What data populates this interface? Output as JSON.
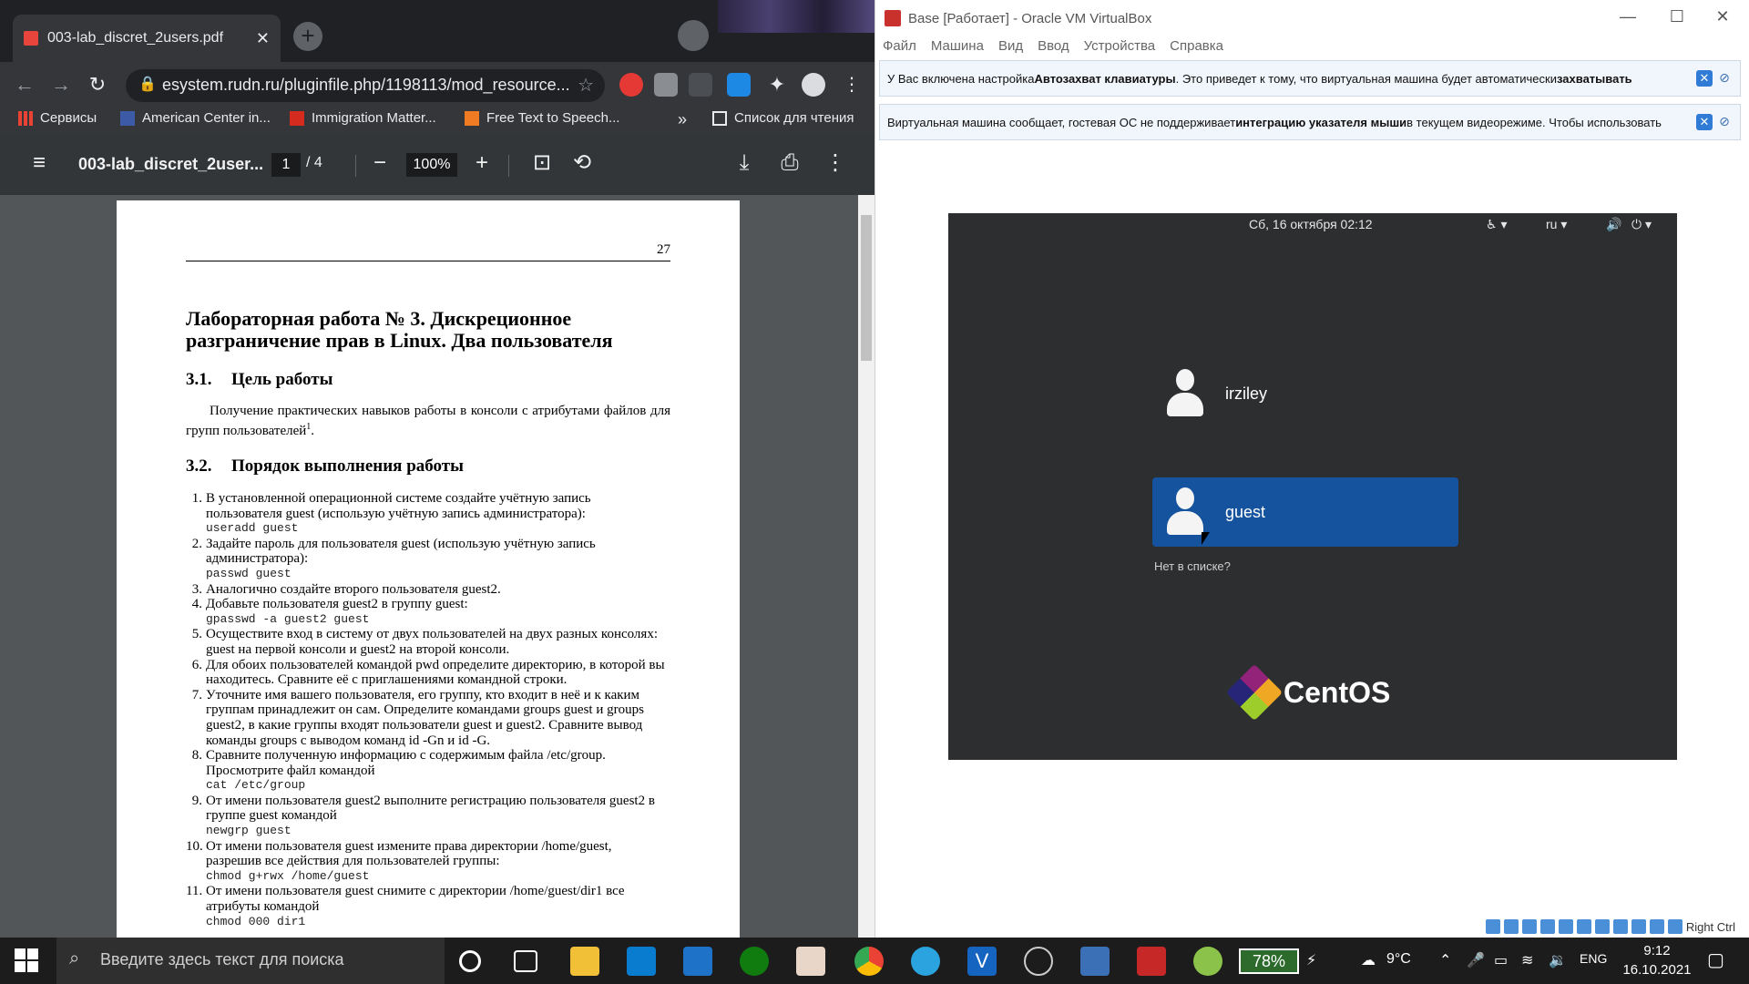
{
  "chrome": {
    "tab_title": "003-lab_discret_2users.pdf",
    "url": "esystem.rudn.ru/pluginfile.php/1198113/mod_resource...",
    "bookmarks": [
      "Сервисы",
      "American Center in...",
      "Immigration Matter...",
      "Free Text to Speech...",
      "Список для чтения"
    ],
    "bookmarks_more": "»"
  },
  "pdf": {
    "title": "003-lab_discret_2user...",
    "page_current": "1",
    "page_total": "/  4",
    "zoom": "100%",
    "page_number": "27",
    "heading": "Лабораторная работа № 3.   Дискреционное разграничение прав в Linux. Два пользователя",
    "sec1_num": "3.1.",
    "sec1_title": "Цель работы",
    "goal": "Получение практических навыков работы в консоли с атрибутами файлов для групп пользователей",
    "goal_sup": "1",
    "sec2_num": "3.2.",
    "sec2_title": "Порядок выполнения работы",
    "steps": [
      {
        "n": "1.",
        "text": "В установленной операционной системе создайте учётную запись пользователя guest (использую учётную запись администратора):",
        "cmd": "useradd guest"
      },
      {
        "n": "2.",
        "text": "Задайте пароль для пользователя guest (использую учётную запись администратора):",
        "cmd": "passwd guest"
      },
      {
        "n": "3.",
        "text": "Аналогично создайте второго пользователя guest2.",
        "cmd": ""
      },
      {
        "n": "4.",
        "text": "Добавьте пользователя guest2 в группу guest:",
        "cmd": "gpasswd -a guest2 guest"
      },
      {
        "n": "5.",
        "text": "Осуществите вход в систему от двух пользователей на двух разных консолях: guest на первой консоли и guest2 на второй консоли.",
        "cmd": ""
      },
      {
        "n": "6.",
        "text": "Для обоих пользователей командой pwd определите директорию, в которой вы находитесь. Сравните её с приглашениями командной строки.",
        "cmd": ""
      },
      {
        "n": "7.",
        "text": "Уточните имя вашего пользователя, его группу, кто входит в неё и к каким группам принадлежит он сам. Определите командами groups guest и groups guest2, в какие группы входят пользователи guest и guest2. Сравните вывод команды groups с выводом команд id -Gn и id -G.",
        "cmd": ""
      },
      {
        "n": "8.",
        "text": "Сравните полученную информацию с содержимым файла /etc/group. Просмотрите файл командой",
        "cmd": "cat /etc/group"
      },
      {
        "n": "9.",
        "text": "От имени пользователя guest2 выполните регистрацию пользователя guest2 в группе guest командой",
        "cmd": "newgrp guest"
      },
      {
        "n": "10.",
        "text": "От имени пользователя guest измените права директории /home/guest, разрешив все действия для пользователей группы:",
        "cmd": "chmod g+rwx /home/guest"
      },
      {
        "n": "11.",
        "text": "От имени пользователя guest снимите с директории /home/guest/dir1 все атрибуты командой",
        "cmd": "chmod 000 dir1"
      }
    ]
  },
  "vbox": {
    "title": "Base [Работает] - Oracle VM VirtualBox",
    "menu": [
      "Файл",
      "Машина",
      "Вид",
      "Ввод",
      "Устройства",
      "Справка"
    ],
    "banner1_pre": "У Вас включена настройка ",
    "banner1_b1": "Автозахват клавиатуры",
    "banner1_mid": ". Это приведет к тому, что виртуальная машина будет автоматически ",
    "banner1_b2": "захватывать",
    "banner2_pre": "Виртуальная машина сообщает, гостевая ОС не поддерживает ",
    "banner2_b": "интеграцию указателя мыши",
    "banner2_post": " в текущем видеорежиме. Чтобы использовать",
    "host_key": "Right Ctrl"
  },
  "guest": {
    "datetime": "Сб, 16 октября  02:12",
    "lang": "ru",
    "users": [
      "irziley",
      "guest"
    ],
    "not_listed": "Нет в списке?",
    "brand": "CentOS"
  },
  "taskbar": {
    "search_placeholder": "Введите здесь текст для поиска",
    "battery": "78%",
    "weather": "9°C",
    "lang": "ENG",
    "time": "9:12",
    "date": "16.10.2021"
  },
  "colors": {
    "selected_user": "#15539e",
    "tab_accent": "#202124"
  }
}
